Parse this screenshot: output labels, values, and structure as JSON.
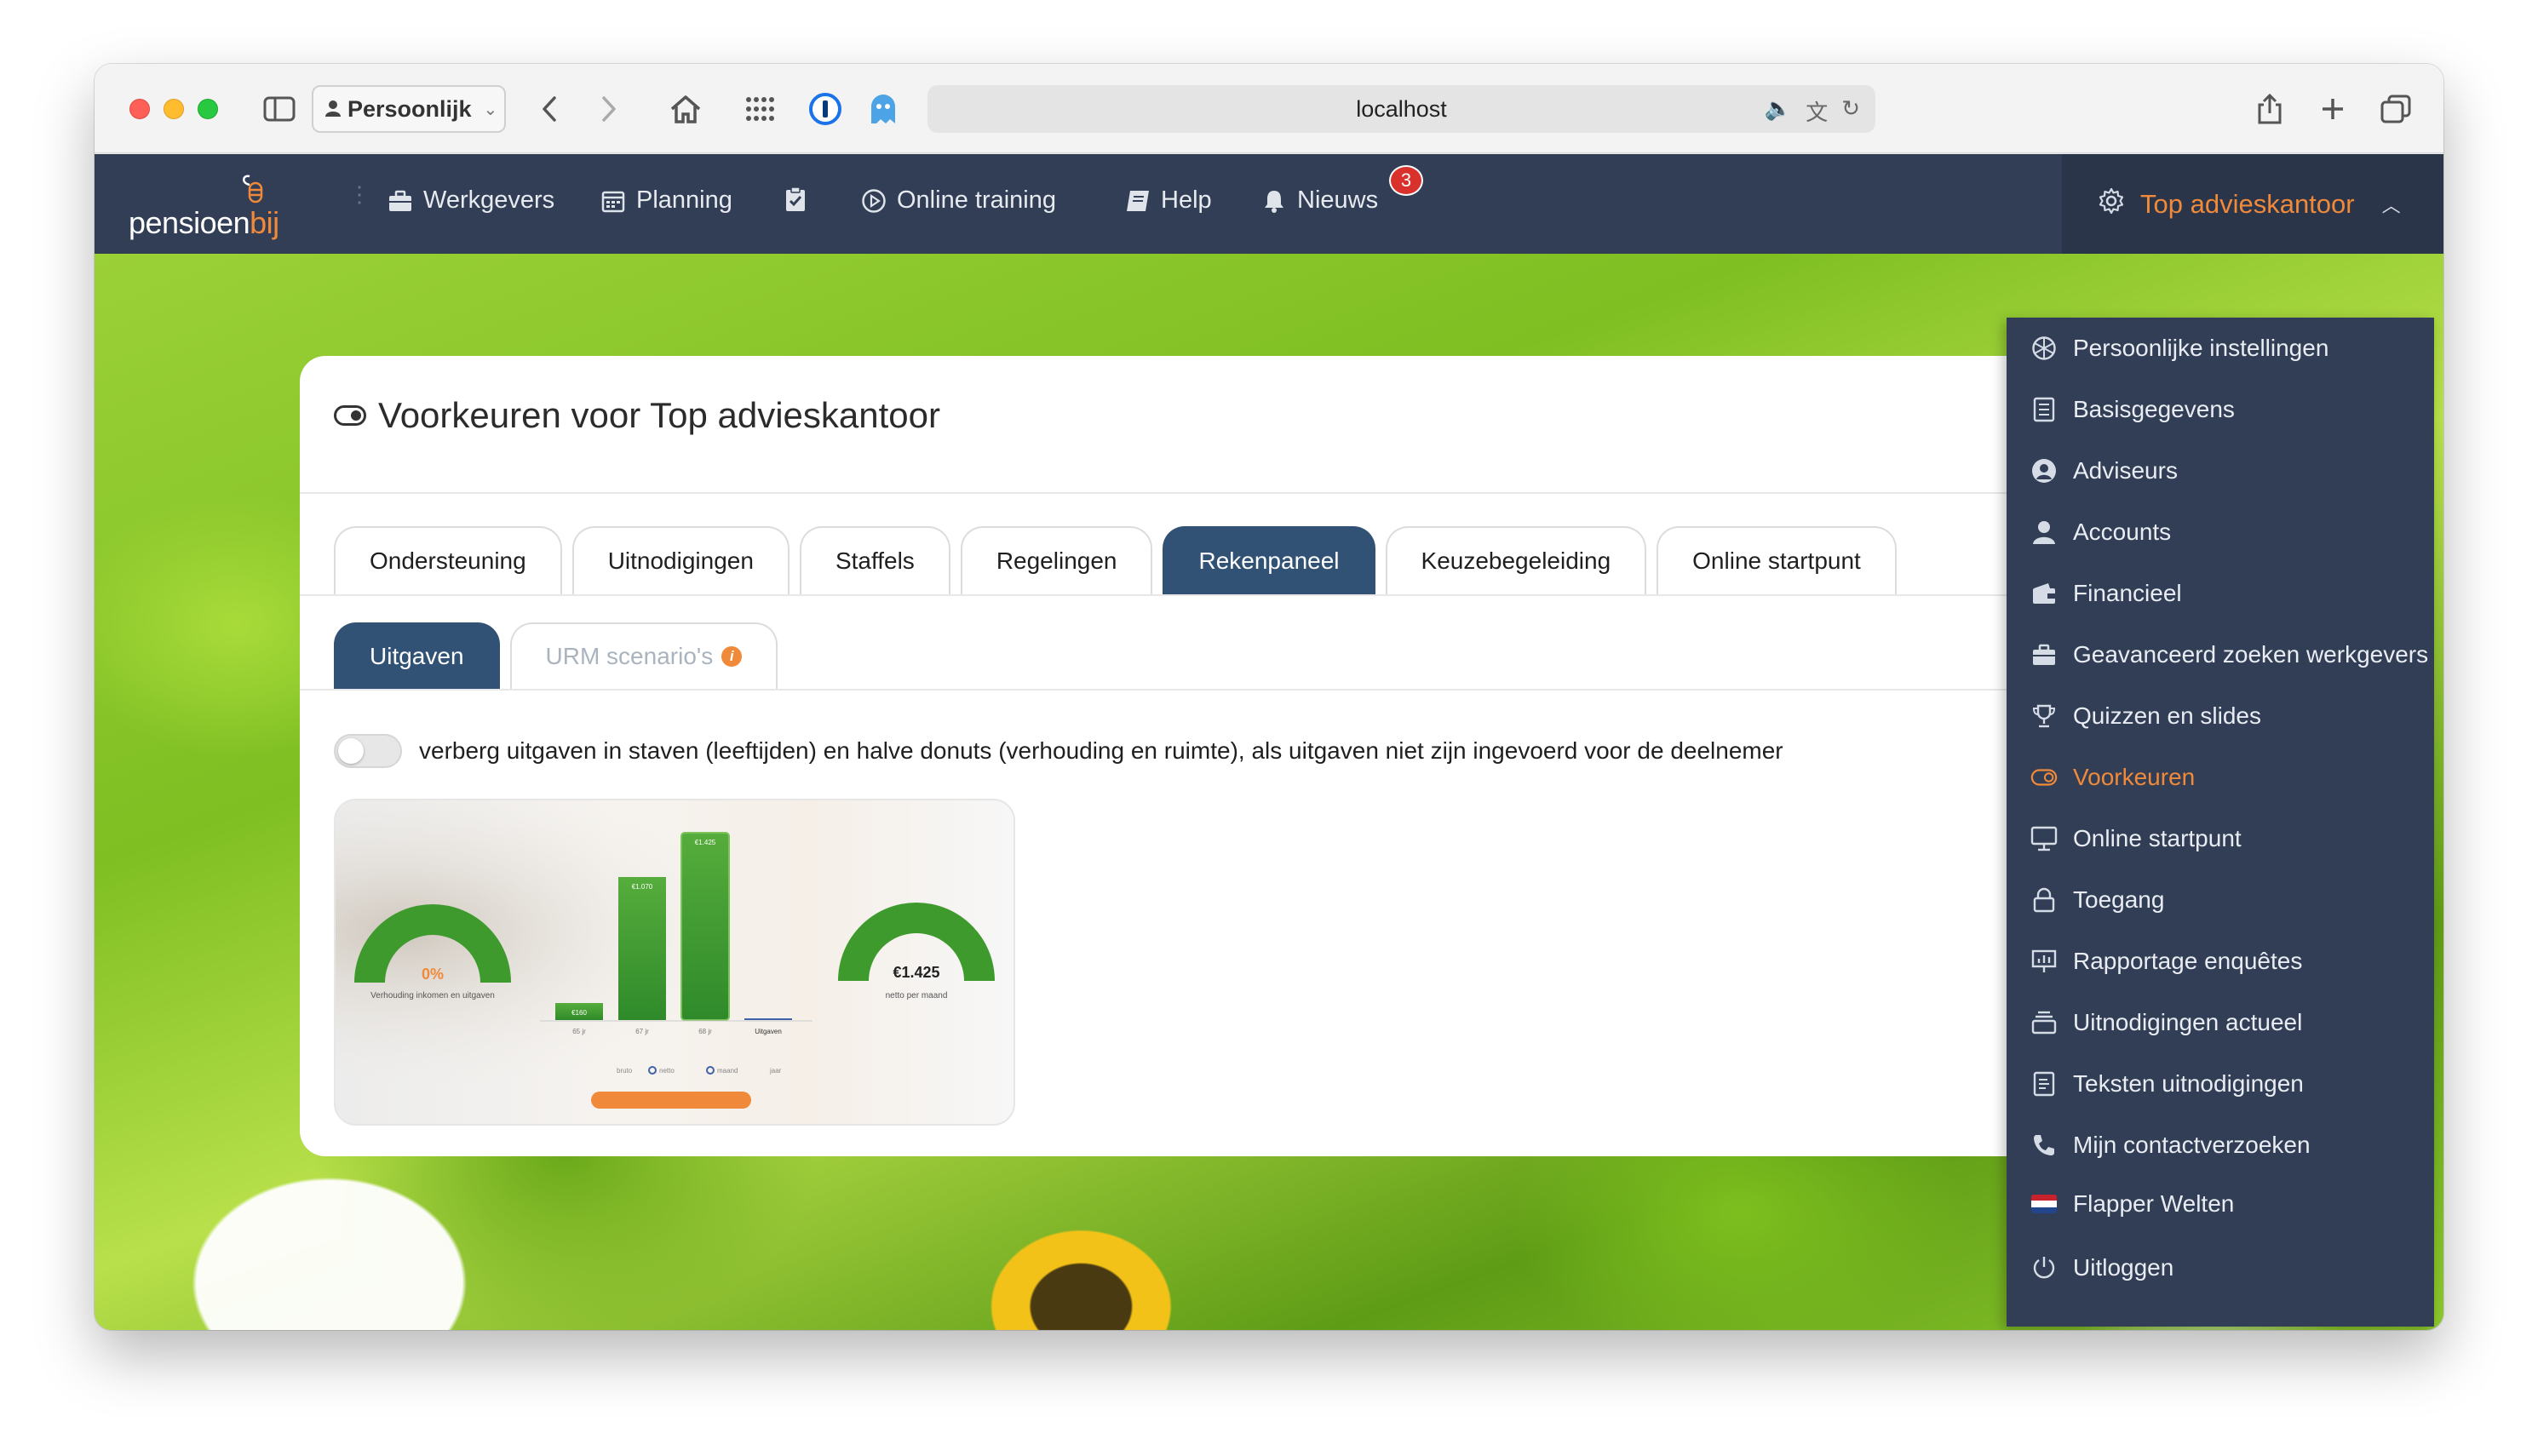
{
  "browser": {
    "profile_label": "Persoonlijk",
    "url": "localhost"
  },
  "nav": {
    "logo_word": "pensioen",
    "logo_accent": "bij",
    "items": [
      {
        "label": "Werkgevers",
        "icon": "briefcase-icon"
      },
      {
        "label": "Planning",
        "icon": "calendar-icon"
      },
      {
        "label": "",
        "icon": "clipboard-check-icon"
      },
      {
        "label": "Online training",
        "icon": "play-circle-icon"
      },
      {
        "label": "Help",
        "icon": "book-icon"
      },
      {
        "label": "Nieuws",
        "icon": "bell-icon"
      }
    ],
    "news_badge": "3",
    "account_label": "Top advieskantoor"
  },
  "card": {
    "title": "Voorkeuren voor Top advieskantoor",
    "tabs": [
      "Ondersteuning",
      "Uitnodigingen",
      "Staffels",
      "Regelingen",
      "Rekenpaneel",
      "Keuzebegeleiding",
      "Online startpunt"
    ],
    "active_tab": "Rekenpaneel",
    "subtabs": [
      "Uitgaven",
      "URM scenario's"
    ],
    "active_subtab": "Uitgaven",
    "switch_label": "verberg uitgaven in staven (leeftijden) en halve donuts (verhouding en ruimte), als uitgaven niet zijn ingevoerd voor de deelnemer",
    "switch_on": false
  },
  "preview": {
    "donut_left_value": "0%",
    "donut_left_label": "Verhouding inkomen en uitgaven",
    "bars": [
      {
        "label": "65 jr",
        "value": "€160"
      },
      {
        "label": "67 jr",
        "value": "€1.070"
      },
      {
        "label": "68 jr",
        "value": "€1.425"
      },
      {
        "label": "Uitgaven",
        "value": ""
      }
    ],
    "toggle_labels": [
      "bruto",
      "netto",
      "maand",
      "jaar"
    ],
    "donut_right_value": "€1.425",
    "donut_right_label": "netto per maand"
  },
  "menu": {
    "items": [
      {
        "label": "Persoonlijke instellingen",
        "icon": "aperture-icon"
      },
      {
        "label": "Basisgegevens",
        "icon": "document-list-icon"
      },
      {
        "label": "Adviseurs",
        "icon": "user-circle-icon"
      },
      {
        "label": "Accounts",
        "icon": "user-icon"
      },
      {
        "label": "Financieel",
        "icon": "wallet-icon"
      },
      {
        "label": "Geavanceerd zoeken werkgevers",
        "icon": "briefcase-icon"
      },
      {
        "label": "Quizzen en slides",
        "icon": "trophy-icon"
      },
      {
        "label": "Voorkeuren",
        "icon": "toggle-icon"
      },
      {
        "label": "Online startpunt",
        "icon": "monitor-icon"
      },
      {
        "label": "Toegang",
        "icon": "lock-icon"
      },
      {
        "label": "Rapportage enquêtes",
        "icon": "presentation-chart-icon"
      },
      {
        "label": "Uitnodigingen actueel",
        "icon": "inbox-stack-icon"
      },
      {
        "label": "Teksten uitnodigingen",
        "icon": "document-text-icon"
      },
      {
        "label": "Mijn contactverzoeken",
        "icon": "phone-icon"
      },
      {
        "label": "Flapper Welten",
        "icon": "dutch-flag-icon"
      },
      {
        "label": "Uitloggen",
        "icon": "power-icon"
      }
    ],
    "active": "Voorkeuren"
  },
  "colors": {
    "nav_bg": "#313e55",
    "accent": "#f08a3a",
    "tab_active": "#315275",
    "badge": "#d9312c",
    "bar_green": "#3f9a2e"
  }
}
